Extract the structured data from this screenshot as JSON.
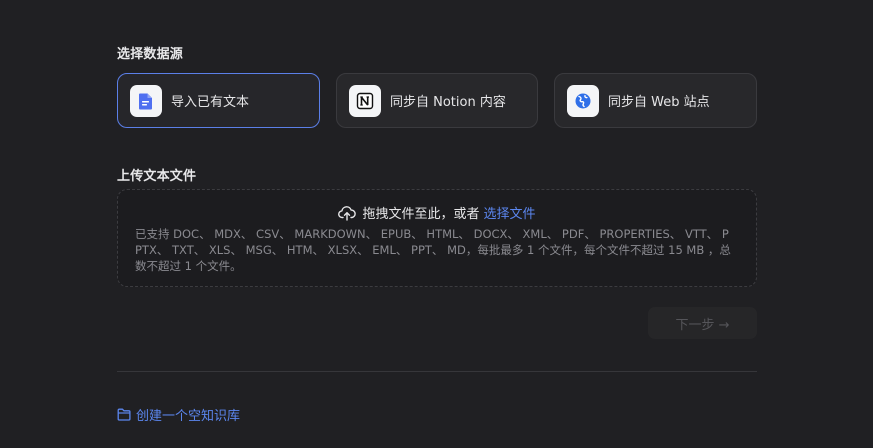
{
  "select_source": {
    "title": "选择数据源",
    "options": [
      {
        "label": "导入已有文本",
        "icon": "document-icon",
        "selected": true
      },
      {
        "label": "同步自 Notion 内容",
        "icon": "notion-icon",
        "selected": false
      },
      {
        "label": "同步自 Web 站点",
        "icon": "globe-icon",
        "selected": false
      }
    ]
  },
  "upload": {
    "title": "上传文本文件",
    "prompt": "拖拽文件至此，或者",
    "link": "选择文件",
    "description": "已支持 DOC、 MDX、 CSV、 MARKDOWN、 EPUB、 HTML、 DOCX、 XML、 PDF、 PROPERTIES、 VTT、 PPTX、 TXT、 XLS、 MSG、 HTM、 XLSX、 EML、 PPT、 MD，每批最多 1 个文件，每个文件不超过 15 MB ，总数不超过 1 个文件。"
  },
  "next_button": {
    "label": "下一步 →",
    "enabled": false
  },
  "create_empty": {
    "label": "创建一个空知识库"
  },
  "colors": {
    "accent": "#5b86ee",
    "selected_border": "#5b7fe8",
    "background": "#202023",
    "card": "#28282b"
  }
}
